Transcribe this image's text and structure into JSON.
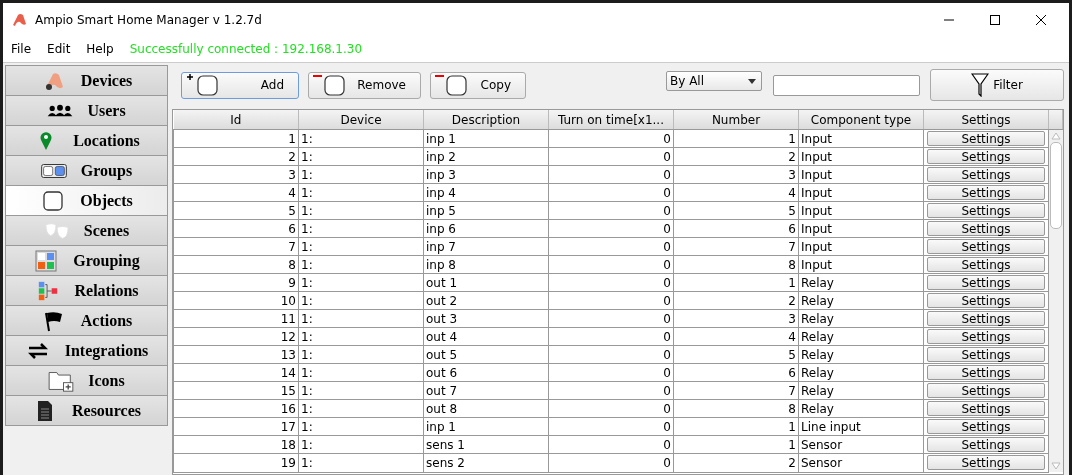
{
  "window": {
    "title": "Ampio Smart Home Manager v 1.2.7d"
  },
  "menu": [
    "File",
    "Edit",
    "Help"
  ],
  "status": "Successfully connected : 192.168.1.30",
  "sidebar": {
    "items": [
      {
        "label": "Devices",
        "selected": false
      },
      {
        "label": "Users",
        "selected": false
      },
      {
        "label": "Locations",
        "selected": false
      },
      {
        "label": "Groups",
        "selected": false
      },
      {
        "label": "Objects",
        "selected": true
      },
      {
        "label": "Scenes",
        "selected": false
      },
      {
        "label": "Grouping",
        "selected": false
      },
      {
        "label": "Relations",
        "selected": false
      },
      {
        "label": "Actions",
        "selected": false
      },
      {
        "label": "Integrations",
        "selected": false
      },
      {
        "label": "Icons",
        "selected": false
      },
      {
        "label": "Resources",
        "selected": false
      }
    ]
  },
  "toolbar": {
    "buttons": [
      {
        "label": "Add",
        "kind": "add"
      },
      {
        "label": "Remove",
        "kind": "remove"
      },
      {
        "label": "Copy",
        "kind": "copy"
      }
    ],
    "filter_by": "By All",
    "filter_button": "Filter"
  },
  "table": {
    "columns": [
      "Id",
      "Device",
      "Description",
      "Turn on time[x1...",
      "Number",
      "Component type",
      "Settings"
    ],
    "rows": [
      [
        "1",
        "1:",
        "inp 1",
        "0",
        "1",
        "Input",
        "Settings"
      ],
      [
        "2",
        "1:",
        "inp 2",
        "0",
        "2",
        "Input",
        "Settings"
      ],
      [
        "3",
        "1:",
        "inp 3",
        "0",
        "3",
        "Input",
        "Settings"
      ],
      [
        "4",
        "1:",
        "inp 4",
        "0",
        "4",
        "Input",
        "Settings"
      ],
      [
        "5",
        "1:",
        "inp 5",
        "0",
        "5",
        "Input",
        "Settings"
      ],
      [
        "6",
        "1:",
        "inp 6",
        "0",
        "6",
        "Input",
        "Settings"
      ],
      [
        "7",
        "1:",
        "inp 7",
        "0",
        "7",
        "Input",
        "Settings"
      ],
      [
        "8",
        "1:",
        "inp 8",
        "0",
        "8",
        "Input",
        "Settings"
      ],
      [
        "9",
        "1:",
        "out 1",
        "0",
        "1",
        "Relay",
        "Settings"
      ],
      [
        "10",
        "1:",
        "out 2",
        "0",
        "2",
        "Relay",
        "Settings"
      ],
      [
        "11",
        "1:",
        "out 3",
        "0",
        "3",
        "Relay",
        "Settings"
      ],
      [
        "12",
        "1:",
        "out 4",
        "0",
        "4",
        "Relay",
        "Settings"
      ],
      [
        "13",
        "1:",
        "out 5",
        "0",
        "5",
        "Relay",
        "Settings"
      ],
      [
        "14",
        "1:",
        "out 6",
        "0",
        "6",
        "Relay",
        "Settings"
      ],
      [
        "15",
        "1:",
        "out 7",
        "0",
        "7",
        "Relay",
        "Settings"
      ],
      [
        "16",
        "1:",
        "out 8",
        "0",
        "8",
        "Relay",
        "Settings"
      ],
      [
        "17",
        "1:",
        "inp 1",
        "0",
        "1",
        "Line input",
        "Settings"
      ],
      [
        "18",
        "1:",
        "sens 1",
        "0",
        "1",
        "Sensor",
        "Settings"
      ],
      [
        "19",
        "1:",
        "sens 2",
        "0",
        "2",
        "Sensor",
        "Settings"
      ]
    ]
  }
}
